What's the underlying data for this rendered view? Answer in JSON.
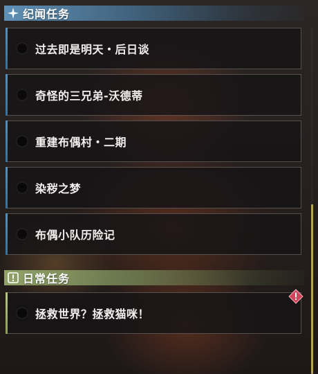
{
  "categories": [
    {
      "title": "纪闻任务",
      "icon": "sparkle-icon",
      "accent": "#6296be",
      "quests": [
        {
          "label": "过去即是明天・后日谈"
        },
        {
          "label": "奇怪的三兄弟-沃德蒂"
        },
        {
          "label": "重建布偶村・二期"
        },
        {
          "label": "染秽之梦"
        },
        {
          "label": "布偶小队历险记"
        }
      ]
    },
    {
      "title": "日常任务",
      "icon": "exclamation-icon",
      "accent": "#96aa6e",
      "quests": [
        {
          "label": "拯救世界？拯救猫咪！",
          "badge": "alert-icon"
        }
      ]
    }
  ],
  "scrollbar_color": "#b7a45a",
  "badge_color": "#d0455a"
}
